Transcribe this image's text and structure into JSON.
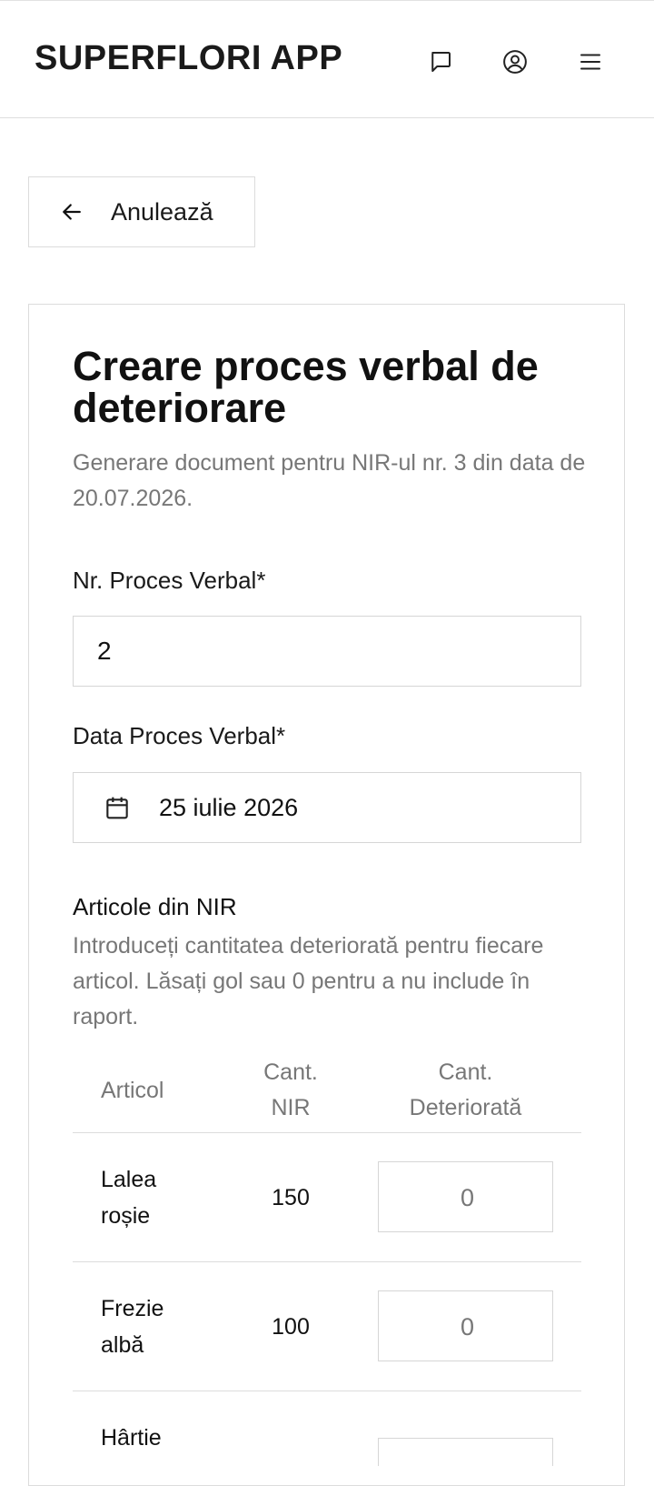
{
  "header": {
    "brand": "SUPERFLORI APP"
  },
  "actions": {
    "back_label": "Anulează"
  },
  "form": {
    "title": "Creare proces verbal de deteriorare",
    "subtitle": "Generare document pentru NIR-ul nr. 3 din data de 20.07.2026.",
    "nr_label": "Nr. Proces Verbal*",
    "nr_value": "2",
    "date_label": "Data Proces Verbal*",
    "date_value": "25 iulie 2026",
    "items_title": "Articole din NIR",
    "items_desc": "Introduceți cantitatea deteriorată pentru fiecare articol. Lăsați gol sau 0 pentru a nu include în raport."
  },
  "table": {
    "headers": {
      "articol": "Articol",
      "cant_nir": "Cant. NIR",
      "cant_det": "Cant. Deteriorată"
    },
    "rows": [
      {
        "name": "Lalea roșie",
        "qty": "150",
        "damaged": "0"
      },
      {
        "name": "Frezie albă",
        "qty": "100",
        "damaged": "0"
      },
      {
        "name": "Hârtie",
        "qty": "",
        "damaged": ""
      }
    ]
  }
}
